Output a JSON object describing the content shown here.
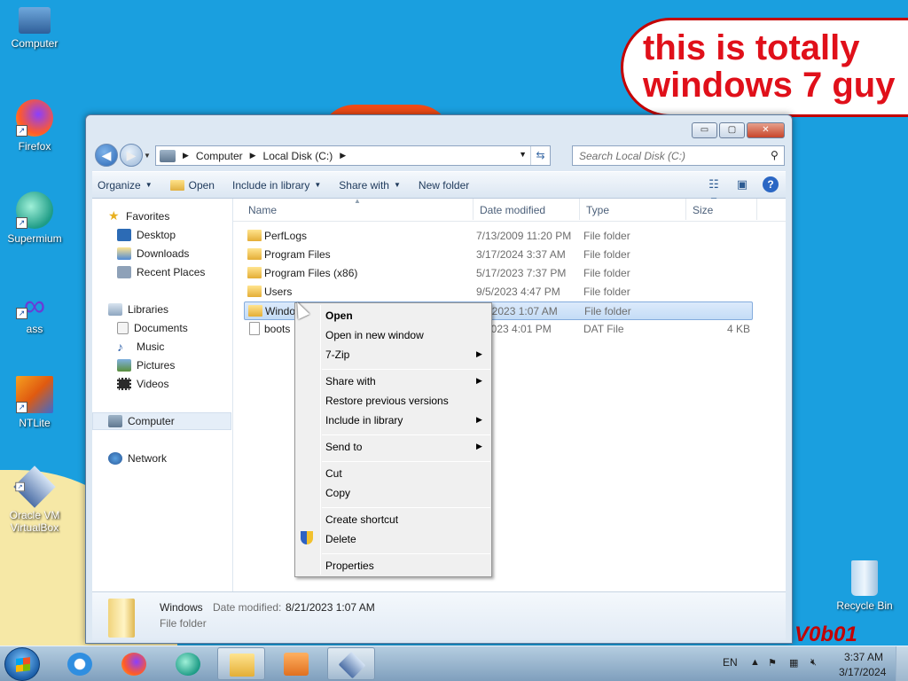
{
  "desktop": {
    "bubble_text": "this is totally\nwindows 7 guy",
    "watermark": "V0b01",
    "icons": [
      {
        "label": "Computer"
      },
      {
        "label": "Firefox"
      },
      {
        "label": "Supermium"
      },
      {
        "label": "ass"
      },
      {
        "label": "NTLite"
      },
      {
        "label": "Oracle VM VirtualBox"
      },
      {
        "label": "Recycle Bin"
      }
    ]
  },
  "explorer": {
    "controls": {
      "minimize": "▭",
      "maximize": "▢",
      "close": "✕"
    },
    "address": {
      "breadcrumb": [
        "Computer",
        "Local Disk (C:)"
      ]
    },
    "search": {
      "placeholder": "Search Local Disk (C:)"
    },
    "toolbar": {
      "organize": "Organize",
      "open": "Open",
      "include_in_library": "Include in library",
      "share_with": "Share with",
      "new_folder": "New folder"
    },
    "nav": {
      "favorites": "Favorites",
      "desktop": "Desktop",
      "downloads": "Downloads",
      "recent_places": "Recent Places",
      "libraries": "Libraries",
      "documents": "Documents",
      "music": "Music",
      "pictures": "Pictures",
      "videos": "Videos",
      "computer": "Computer",
      "network": "Network"
    },
    "columns": {
      "name": "Name",
      "date_modified": "Date modified",
      "type": "Type",
      "size": "Size"
    },
    "files": [
      {
        "name": "PerfLogs",
        "date": "7/13/2009 11:20 PM",
        "type": "File folder",
        "size": ""
      },
      {
        "name": "Program Files",
        "date": "3/17/2024 3:37 AM",
        "type": "File folder",
        "size": ""
      },
      {
        "name": "Program Files (x86)",
        "date": "5/17/2023 7:37 PM",
        "type": "File folder",
        "size": ""
      },
      {
        "name": "Users",
        "date": "9/5/2023 4:47 PM",
        "type": "File folder",
        "size": ""
      },
      {
        "name": "Windo",
        "date": "21/2023 1:07 AM",
        "type": "File folder",
        "size": ""
      },
      {
        "name": "boots",
        "date": "5/2023 4:01 PM",
        "type": "DAT File",
        "size": "4 KB"
      }
    ],
    "details": {
      "name": "Windows",
      "modified_label": "Date modified:",
      "modified": "8/21/2023 1:07 AM",
      "type": "File folder"
    }
  },
  "context_menu": {
    "open": "Open",
    "open_new_window": "Open in new window",
    "seven_zip": "7-Zip",
    "share_with": "Share with",
    "restore_previous": "Restore previous versions",
    "include_in_library": "Include in library",
    "send_to": "Send to",
    "cut": "Cut",
    "copy": "Copy",
    "create_shortcut": "Create shortcut",
    "delete": "Delete",
    "properties": "Properties"
  },
  "taskbar": {
    "lang": "EN",
    "time": "3:37 AM",
    "date": "3/17/2024"
  }
}
